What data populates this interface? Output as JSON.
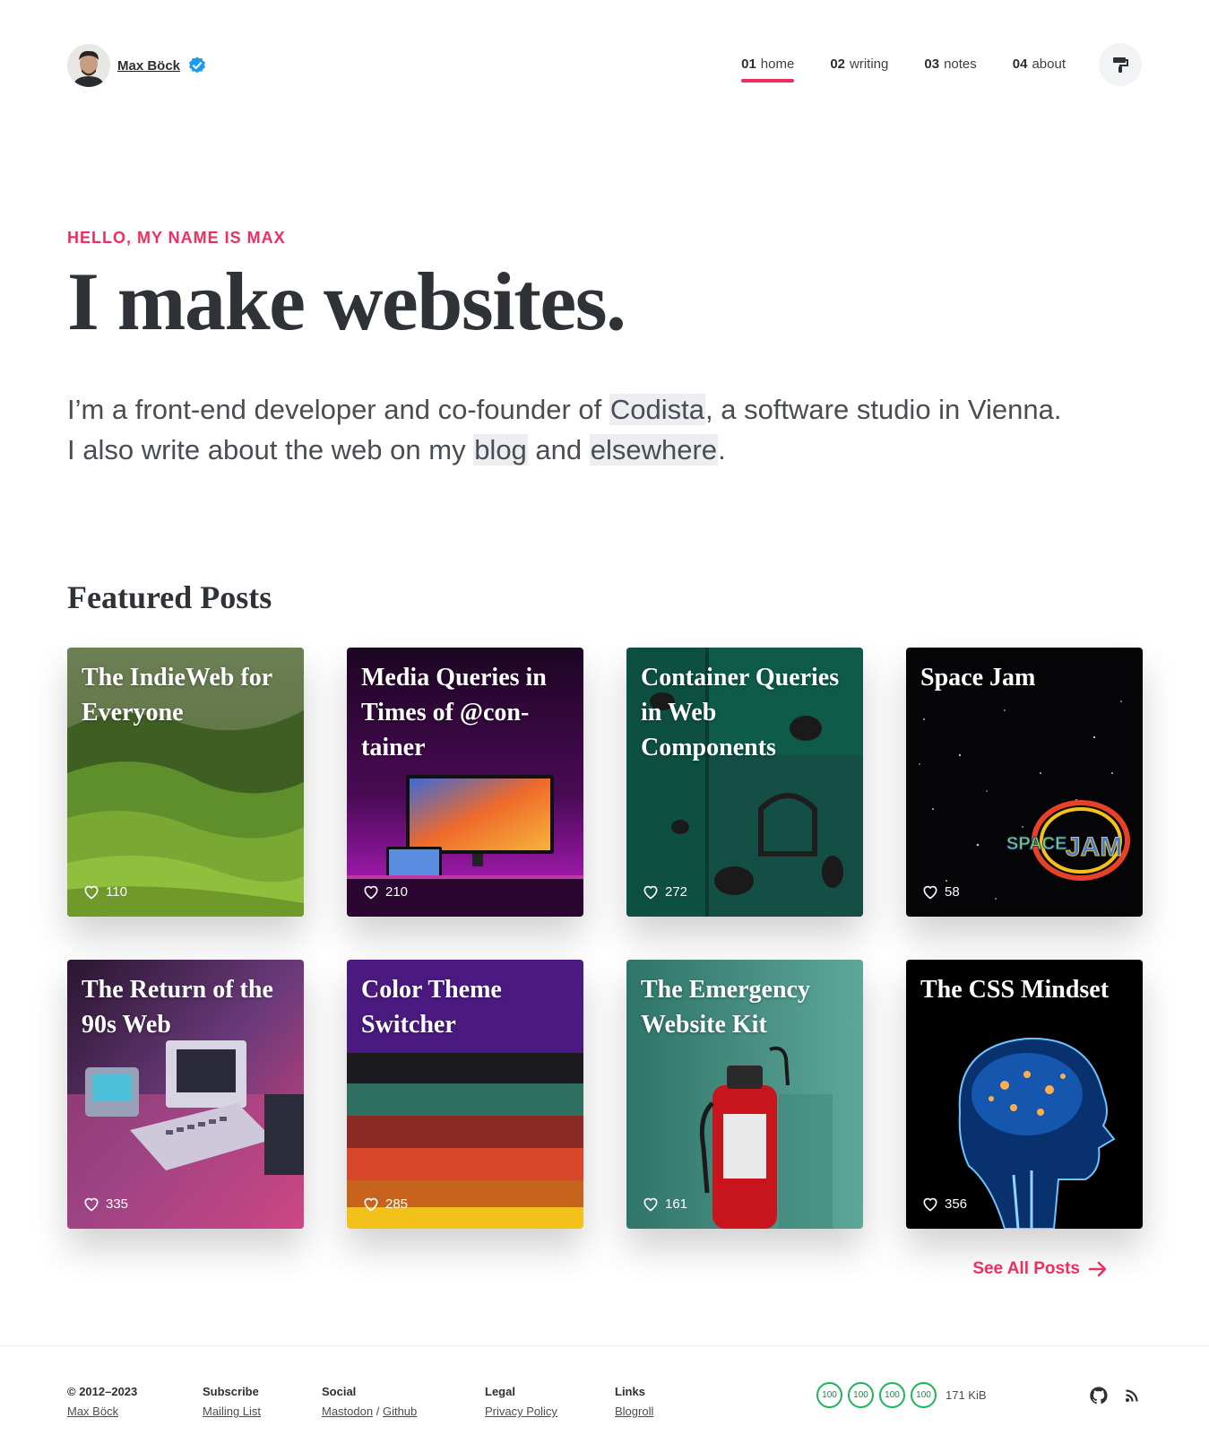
{
  "header": {
    "brand_name": "Max Böck",
    "nav": [
      {
        "num": "01",
        "label": "home",
        "active": true
      },
      {
        "num": "02",
        "label": "writing",
        "active": false
      },
      {
        "num": "03",
        "label": "notes",
        "active": false
      },
      {
        "num": "04",
        "label": "about",
        "active": false
      }
    ]
  },
  "hero": {
    "eyebrow": "HELLO, MY NAME IS MAX",
    "title": "I make websites.",
    "text_1": "I’m a front-end developer and co-founder of ",
    "link_codista": "Codista",
    "text_2": ", a software studio in Vienna.",
    "text_3": "I also write about the web on my ",
    "link_blog": "blog",
    "text_4": " and ",
    "link_elsewhere": "elsewhere",
    "text_5": "."
  },
  "featured": {
    "title": "Featured Posts",
    "posts": [
      {
        "title": "The IndieWeb for Everyone",
        "likes": "110"
      },
      {
        "title": "Media Queries in Times of @con­tainer",
        "likes": "210"
      },
      {
        "title": "Container Queries in Web Components",
        "likes": "272"
      },
      {
        "title": "Space Jam",
        "likes": "58"
      },
      {
        "title": "The Return of the 90s Web",
        "likes": "335"
      },
      {
        "title": "Color Theme Switcher",
        "likes": "285"
      },
      {
        "title": "The Emergency Website Kit",
        "likes": "161"
      },
      {
        "title": "The CSS Mindset",
        "likes": "356"
      }
    ],
    "see_all": "See All Posts"
  },
  "footer": {
    "copyright": "© 2012–2023",
    "copyright_link": "Max Böck",
    "subscribe_heading": "Subscribe",
    "subscribe_link": "Mailing List",
    "social_heading": "Social",
    "social_link_1": "Mastodon",
    "social_sep": "/",
    "social_link_2": "Github",
    "legal_heading": "Legal",
    "legal_link": "Privacy Policy",
    "links_heading": "Links",
    "links_link": "Blogroll",
    "scores": [
      "100",
      "100",
      "100",
      "100"
    ],
    "page_weight": "171 KiB"
  },
  "colors": {
    "accent": "#ed2f60",
    "score_green": "#1bb55c"
  }
}
